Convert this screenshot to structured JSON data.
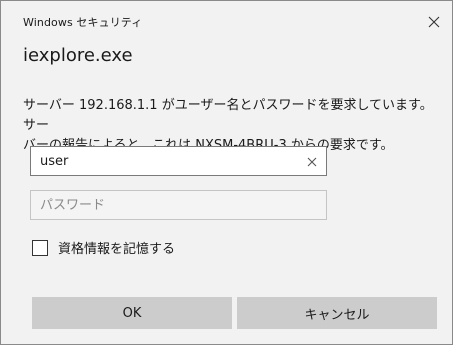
{
  "window": {
    "title": "Windows セキュリティ",
    "close_icon": "close-icon"
  },
  "app": {
    "name": "iexplore.exe"
  },
  "message": {
    "line1": "サーバー 192.168.1.1 がユーザー名とパスワードを要求しています。サー",
    "line2": "バーの報告によると、これは NXSM-4BRU-3 からの要求です。"
  },
  "form": {
    "username_value": "user",
    "password_placeholder": "パスワード",
    "clear_icon": "clear-icon",
    "remember_label": "資格情報を記憶する",
    "remember_checked": false
  },
  "buttons": {
    "ok_label": "OK",
    "cancel_label": "キャンセル"
  },
  "colors": {
    "dialog_bg": "#f2f2f2",
    "button_bg": "#cccccc",
    "text": "#1a1a1a"
  }
}
